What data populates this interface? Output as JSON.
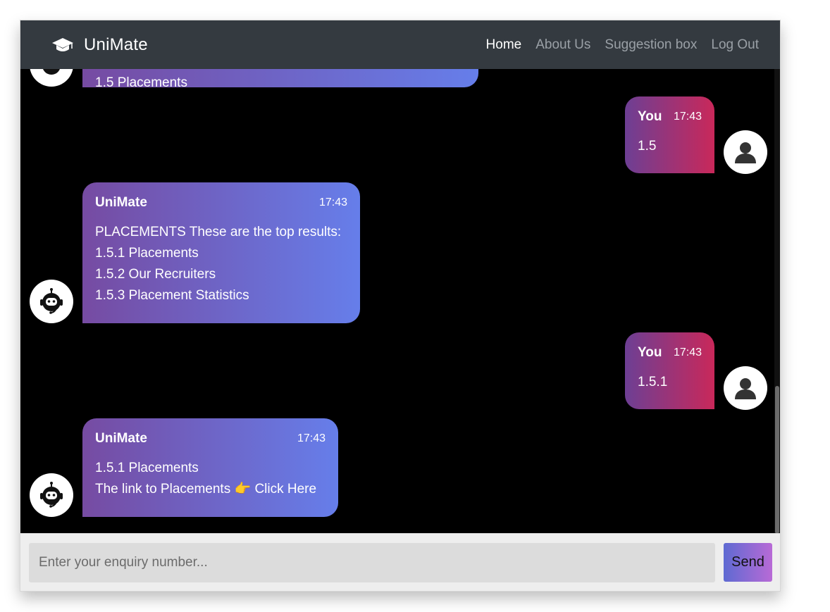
{
  "navbar": {
    "brand": "UniMate",
    "links": [
      "Home",
      "About Us",
      "Suggestion box",
      "Log Out"
    ]
  },
  "messages": {
    "partial_bot_text": "1.5 Placements",
    "user1": {
      "sender": "You",
      "time": "17:43",
      "text": "1.5"
    },
    "bot1": {
      "sender": "UniMate",
      "time": "17:43",
      "lines": [
        "PLACEMENTS These are the top results:",
        "1.5.1 Placements",
        "1.5.2 Our Recruiters",
        "1.5.3 Placement Statistics"
      ]
    },
    "user2": {
      "sender": "You",
      "time": "17:43",
      "text": "1.5.1"
    },
    "bot2": {
      "sender": "UniMate",
      "time": "17:43",
      "line1": "1.5.1 Placements",
      "link_prefix": "The link to Placements",
      "pointer": "👉",
      "link_text": "Click Here"
    }
  },
  "composer": {
    "placeholder": "Enter your enquiry number...",
    "send_label": "Send"
  }
}
